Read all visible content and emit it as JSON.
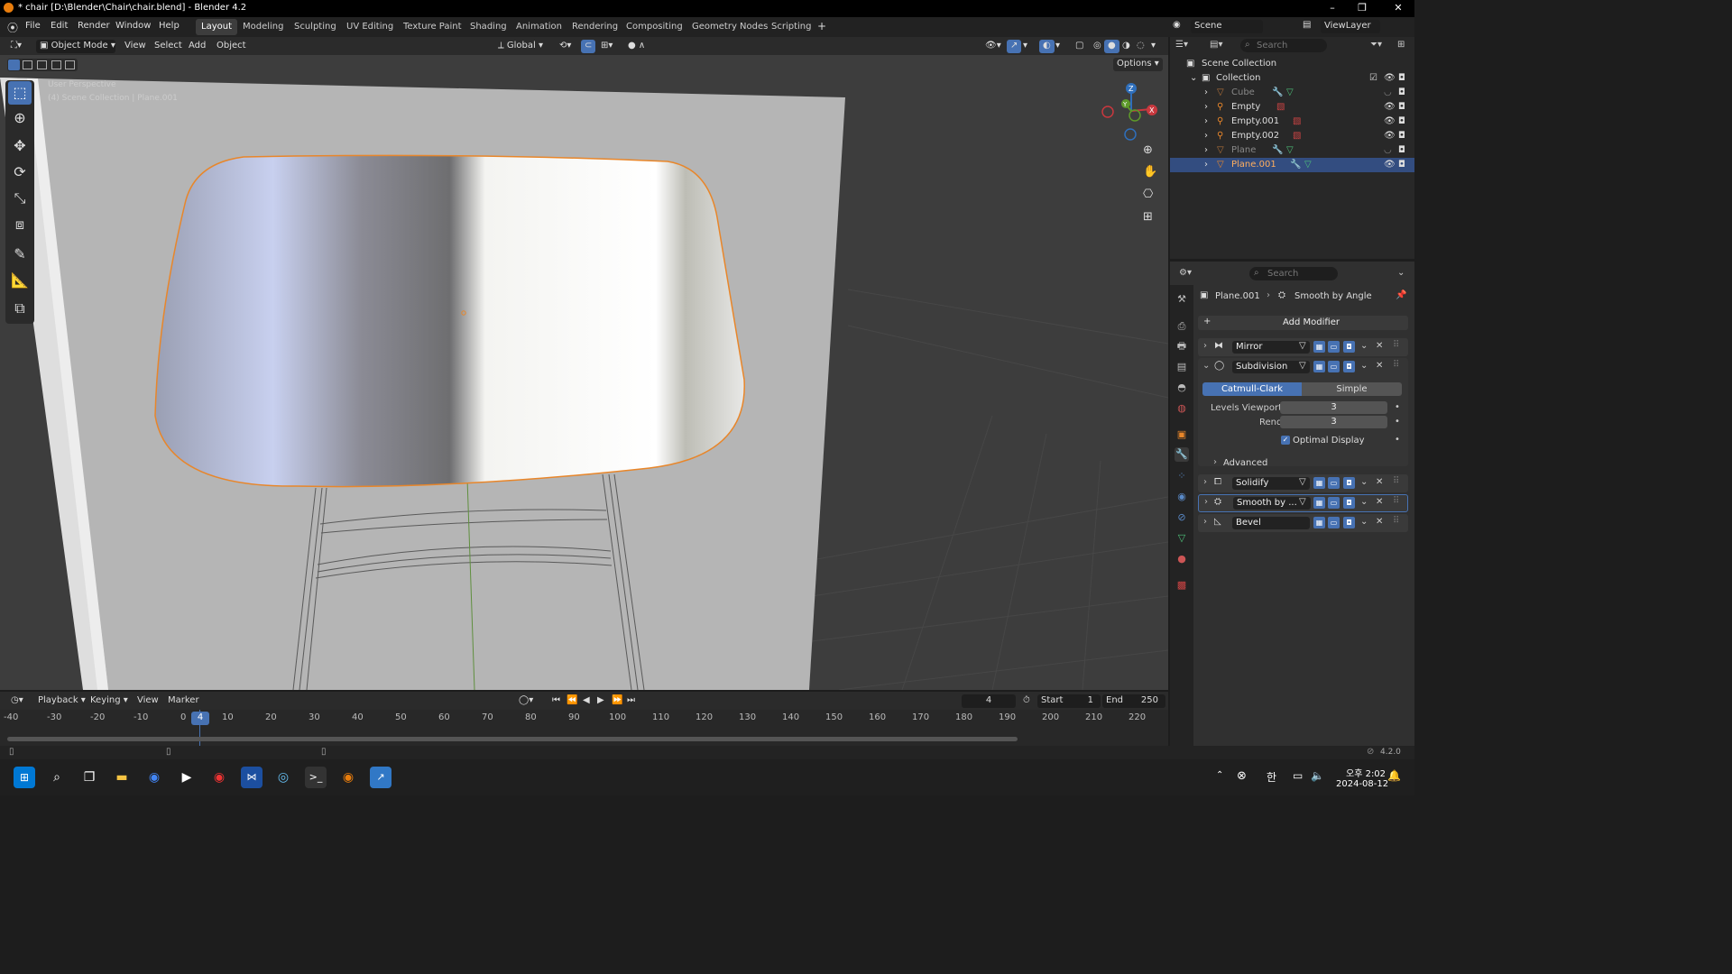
{
  "window": {
    "title": "* chair [D:\\Blender\\Chair\\chair.blend] - Blender 4.2"
  },
  "menu": [
    "File",
    "Edit",
    "Render",
    "Window",
    "Help"
  ],
  "workspaces": [
    "Layout",
    "Modeling",
    "Sculpting",
    "UV Editing",
    "Texture Paint",
    "Shading",
    "Animation",
    "Rendering",
    "Compositing",
    "Geometry Nodes",
    "Scripting"
  ],
  "scene": {
    "label": "Scene",
    "view_layer": "ViewLayer"
  },
  "viewport_header": {
    "mode": "Object Mode",
    "view": "View",
    "select": "Select",
    "add": "Add",
    "object": "Object",
    "orientation": "Global",
    "options": "Options"
  },
  "viewport": {
    "perspective": "User Perspective",
    "context": "(4) Scene Collection | Plane.001",
    "gizmo": {
      "z": "Z",
      "y": "Y",
      "x": "X"
    }
  },
  "outliner": {
    "search_placeholder": "Search",
    "scene_collection": "Scene Collection",
    "collection": "Collection",
    "items": [
      {
        "name": "Cube",
        "hidden": true,
        "selected": false
      },
      {
        "name": "Empty",
        "hidden": false,
        "selected": false
      },
      {
        "name": "Empty.001",
        "hidden": false,
        "selected": false
      },
      {
        "name": "Empty.002",
        "hidden": false,
        "selected": false
      },
      {
        "name": "Plane",
        "hidden": true,
        "selected": false
      },
      {
        "name": "Plane.001",
        "hidden": false,
        "selected": true
      }
    ]
  },
  "properties": {
    "search_placeholder": "Search",
    "breadcrumb_object": "Plane.001",
    "breadcrumb_modifier": "Smooth by Angle",
    "add_modifier": "Add Modifier",
    "modifiers": [
      "Mirror",
      "Subdivision",
      "Solidify",
      "Smooth by ...",
      "Bevel"
    ],
    "subdivision": {
      "type_active": "Catmull-Clark",
      "type_other": "Simple",
      "levels_viewport_label": "Levels Viewport",
      "levels_viewport": "3",
      "render_label": "Render",
      "render": "3",
      "optimal_display": "Optimal Display",
      "advanced": "Advanced"
    }
  },
  "timeline": {
    "playback": "Playback",
    "keying": "Keying",
    "view": "View",
    "marker": "Marker",
    "current_frame": "4",
    "start_label": "Start",
    "start": "1",
    "end_label": "End",
    "end": "250",
    "ticks": [
      "-40",
      "-30",
      "-20",
      "-10",
      "0",
      "10",
      "20",
      "30",
      "40",
      "50",
      "60",
      "70",
      "80",
      "90",
      "100",
      "110",
      "120",
      "130",
      "140",
      "150",
      "160",
      "170",
      "180",
      "190",
      "200",
      "210",
      "220"
    ],
    "playhead": "4"
  },
  "status": {
    "version": "4.2.0"
  },
  "taskbar": {
    "time": "오후 2:02",
    "date": "2024-08-12",
    "ime": "한"
  }
}
